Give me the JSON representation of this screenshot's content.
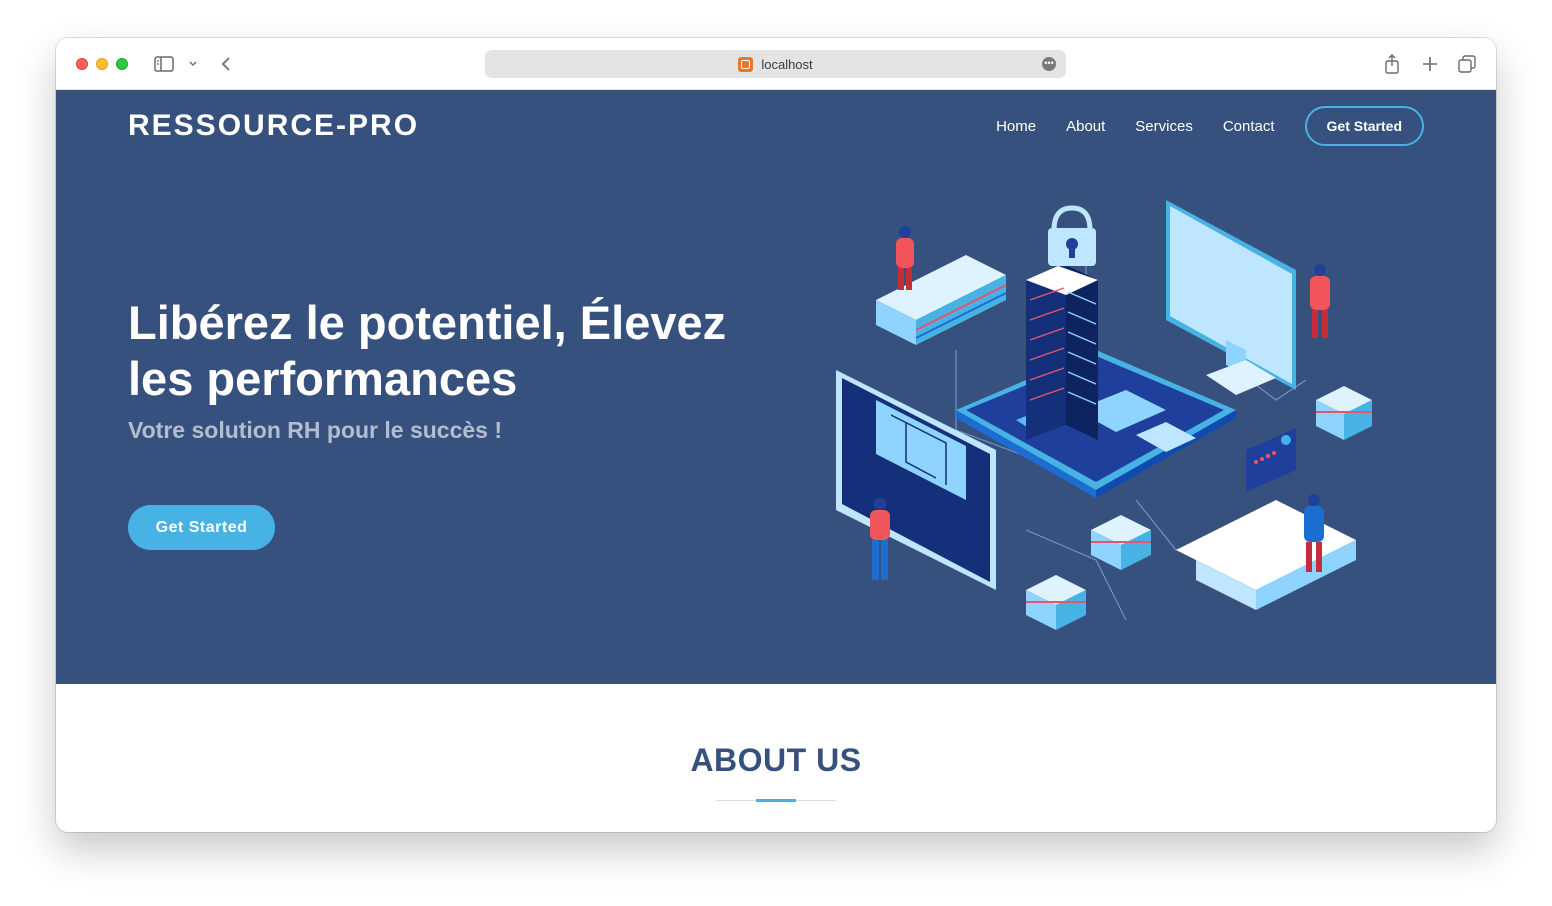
{
  "browser": {
    "url": "localhost"
  },
  "site": {
    "logo": "RESSOURCE-PRO",
    "nav": {
      "items": [
        "Home",
        "About",
        "Services",
        "Contact"
      ],
      "cta": "Get Started"
    }
  },
  "hero": {
    "title_line1": "Libérez le potentiel, Élevez",
    "title_line2": "les performances",
    "subtitle": "Votre solution RH pour le succès !",
    "button": "Get Started"
  },
  "about": {
    "title": "ABOUT US"
  },
  "colors": {
    "hero_bg": "#37517e",
    "accent": "#47b2e4",
    "white": "#ffffff"
  }
}
